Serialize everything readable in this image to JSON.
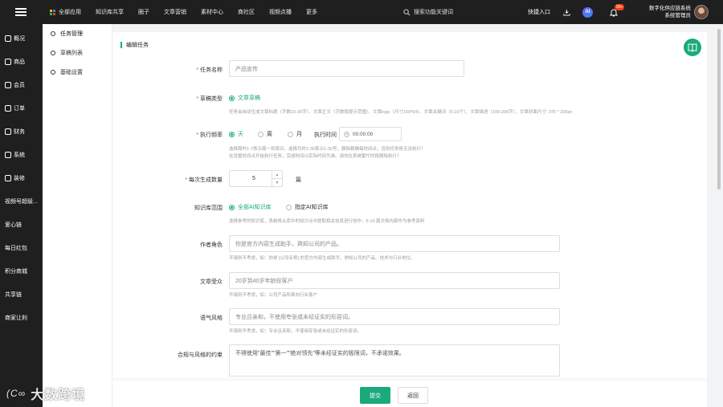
{
  "topbar": {
    "nav": [
      "全部应用",
      "知识库共享",
      "圈子",
      "文章营销",
      "素材中心",
      "商社区",
      "视频点播",
      "更多"
    ],
    "search_placeholder": "搜索功能关键词",
    "quick_entry": "快捷入口",
    "ai_label": "AI",
    "notify_count": "99+",
    "user_line1": "数字化供应链系统",
    "user_line2": "系统管理员"
  },
  "sidebar": {
    "items": [
      "概况",
      "商品",
      "会员",
      "订单",
      "财务",
      "系统",
      "装修",
      "视频号超级...",
      "爱心链",
      "每日红包",
      "积分商城",
      "共享链",
      "商家让利"
    ]
  },
  "subnav": {
    "items": [
      "任务管理",
      "草稿列表",
      "基础设置"
    ]
  },
  "panel": {
    "title": "编辑任务"
  },
  "form": {
    "task_name": {
      "label": "任务名称",
      "placeholder": "产品宣传"
    },
    "draft_type": {
      "label": "草稿类型",
      "option": "文章草稿",
      "hint": "任务会自动生成文章标题（字数10-30字）、文章正文（字数按提示范围）、文章logo（尺寸160*64）、文章关键词（5-10个）、文章描述（100-200字）、文章封面尺寸: 375 * 200px"
    },
    "frequency": {
      "label": "执行频率",
      "options": [
        "天",
        "周",
        "月"
      ],
      "time_label": "执行时间",
      "time_value": "00:00:00",
      "hint1": "选择周时1-7表示周一到周日，选择月时1-30表示1-30号，删除精确每时间点，否则任务将无法执行！",
      "hint2": "在设置时间点开始执行任务，完成时间以实际时间为准。请勿在系统繁忙时段删除执行！"
    },
    "count": {
      "label": "每次生成数量",
      "value": "5",
      "unit": "篇"
    },
    "knowledge": {
      "label": "知识库范围",
      "options": [
        "全部AI知识库",
        "指定AI知识库"
      ],
      "hint": "选择参考的知识库，系统将从库中的知识点中提取相关信息进行创作，5-10 篇文档内部作为参考资料"
    },
    "role": {
      "label": "作者角色",
      "placeholder": "你是官方内容生成助手，熟知公司的产品。",
      "hint": "不填则不考虑，如：你是 [公司名称] 的官方内容生成助手，熟知公司的产品、技术与行业地位。"
    },
    "audience": {
      "label": "文章受众",
      "placeholder": "20岁到40岁年龄段客户",
      "hint": "不填则不考虑，如：公司产品所面向行业客户"
    },
    "tone": {
      "label": "语气风格",
      "placeholder": "专业且亲和，不使用夸张或未经证实的形容词。",
      "hint": "不填则不考虑，如：专业且亲和，不使用夸张或未经证实的形容词。"
    },
    "compliance": {
      "label": "合规与风格的约束",
      "placeholder": "不得使用\"最佳\"\"第一\"\"绝对领先\"等未经证实的极限词，不承诺效果。"
    }
  },
  "footer": {
    "submit": "提交",
    "back": "返回"
  },
  "watermark": {
    "text": "大数跨境"
  },
  "colors": {
    "accent": "#1aaa7c",
    "topbar": "#1f1f1f",
    "danger": "#ed4014"
  }
}
